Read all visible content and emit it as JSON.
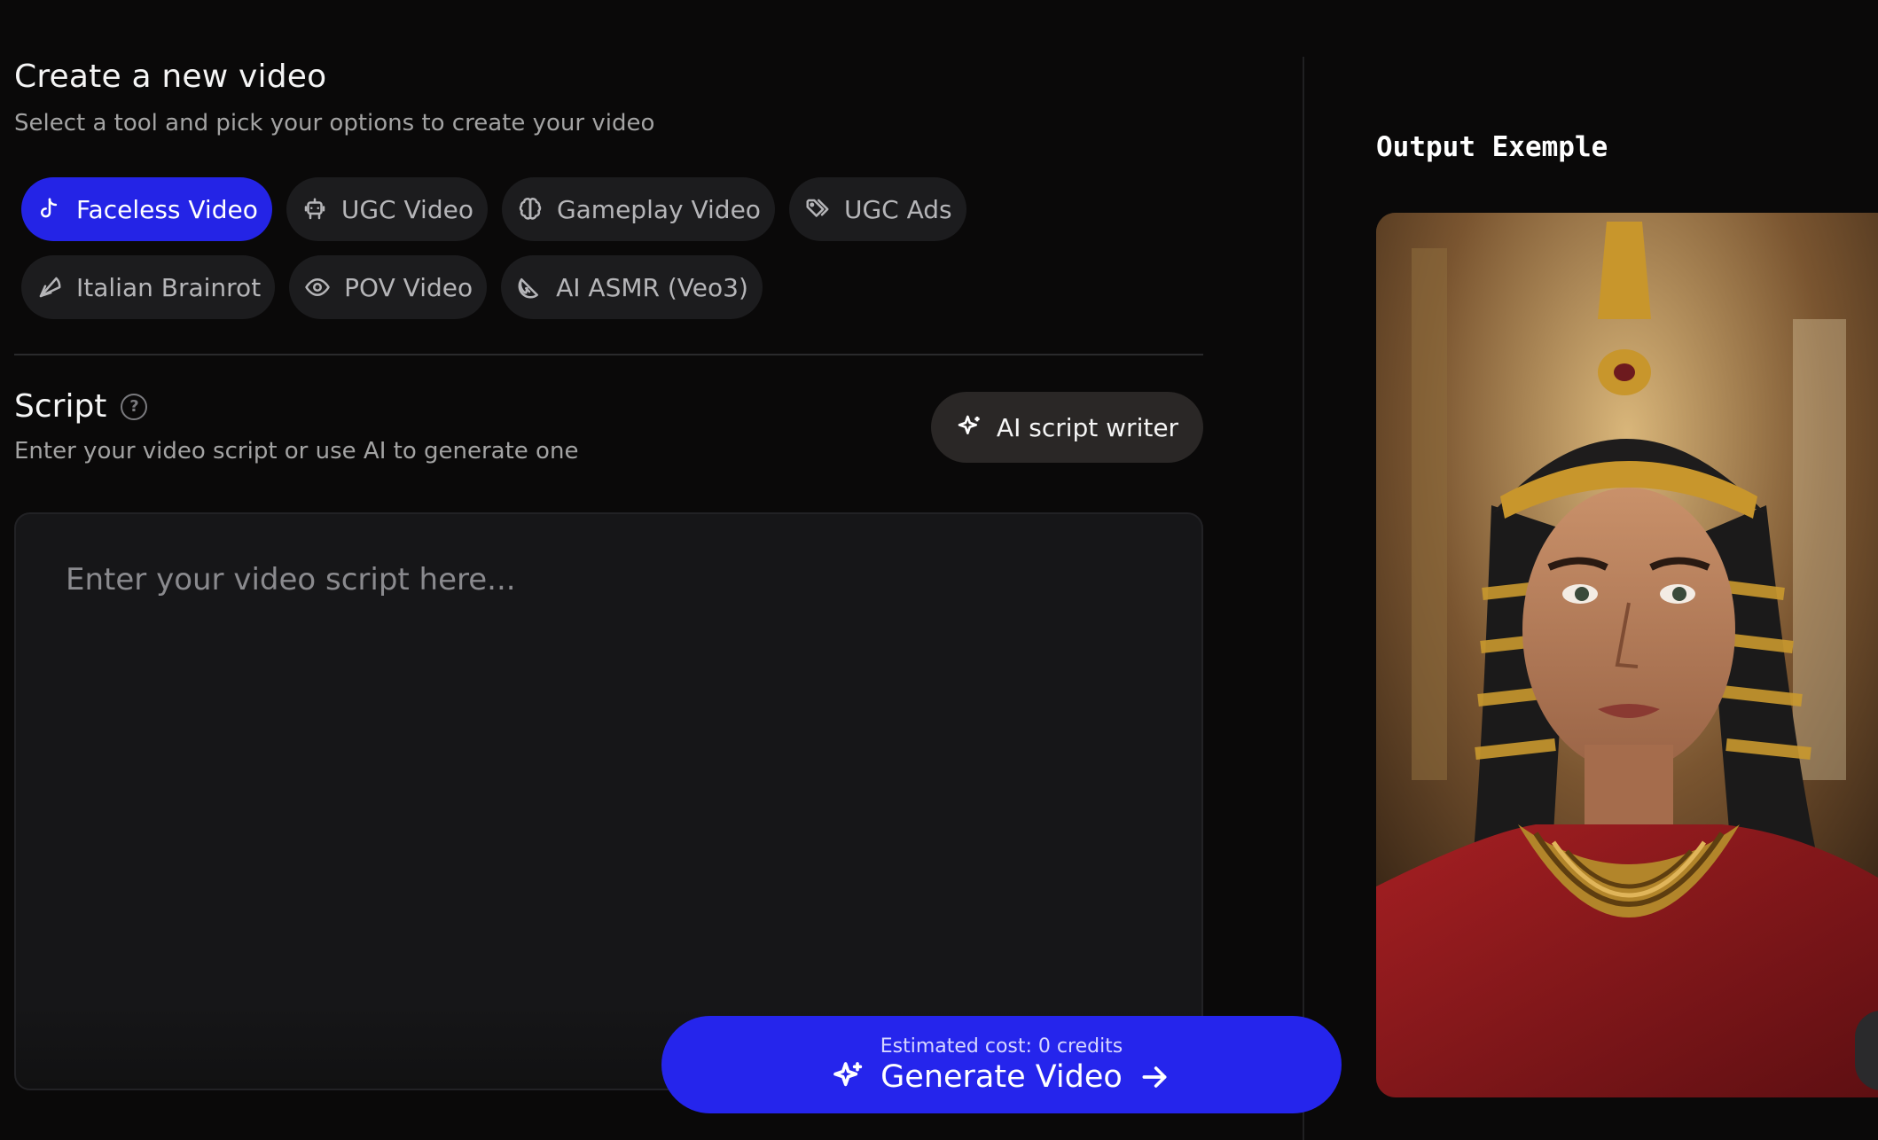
{
  "header": {
    "title": "Create a new video",
    "subtitle": "Select a tool and pick your options to create your video"
  },
  "tools": {
    "row1": [
      {
        "label": "Faceless Video",
        "icon": "tiktok-icon",
        "active": true
      },
      {
        "label": "UGC Video",
        "icon": "robot-icon",
        "active": false
      },
      {
        "label": "Gameplay Video",
        "icon": "brain-icon",
        "active": false
      },
      {
        "label": "UGC Ads",
        "icon": "tags-icon",
        "active": false
      }
    ],
    "row2": [
      {
        "label": "Italian Brainrot",
        "icon": "pizza-icon",
        "active": false
      },
      {
        "label": "POV Video",
        "icon": "eye-icon",
        "active": false
      },
      {
        "label": "AI ASMR (Veo3)",
        "icon": "citrus-icon",
        "active": false
      }
    ]
  },
  "script": {
    "title": "Script",
    "help": "?",
    "subtitle": "Enter your video script or use AI to generate one",
    "ai_writer_label": "AI script writer",
    "placeholder": "Enter your video script here..."
  },
  "output": {
    "title": "Output Exemple"
  },
  "generate": {
    "cost": "Estimated cost: 0 credits",
    "label": "Generate Video"
  },
  "colors": {
    "accent": "#2525ec",
    "background": "#0a0909",
    "chip": "#1c1c1e"
  }
}
